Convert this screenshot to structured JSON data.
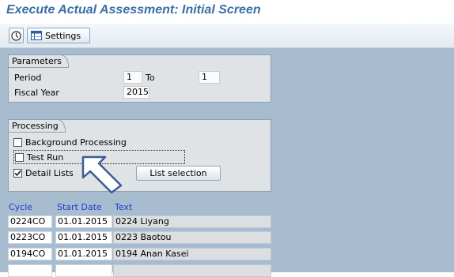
{
  "title": "Execute Actual Assessment: Initial Screen",
  "toolbar": {
    "execute_icon": "execute-icon",
    "settings_label": "Settings"
  },
  "parameters": {
    "heading": "Parameters",
    "period_label": "Period",
    "period_from": "1",
    "to_label": "To",
    "period_to": "1",
    "fiscal_year_label": "Fiscal Year",
    "fiscal_year": "2015"
  },
  "processing": {
    "heading": "Processing",
    "background_label": "Background Processing",
    "background_checked": false,
    "test_run_label": "Test Run",
    "test_run_checked": false,
    "detail_lists_label": "Detail Lists",
    "detail_lists_checked": true,
    "list_selection_label": "List selection"
  },
  "table": {
    "headers": [
      "Cycle",
      "Start Date",
      "Text"
    ],
    "rows": [
      {
        "cycle": "0224CO",
        "start_date": "01.01.2015",
        "text": "0224 Liyang"
      },
      {
        "cycle": "0223CO",
        "start_date": "01.01.2015",
        "text": "0223 Baotou"
      },
      {
        "cycle": "0194CO",
        "start_date": "01.01.2015",
        "text": "0194 Anan Kasei"
      },
      {
        "cycle": "",
        "start_date": "",
        "text": ""
      }
    ]
  },
  "colors": {
    "title": "#3a6ea5",
    "background": "#a8bccf",
    "group": "#dfe3e6",
    "column_header": "#1d3fd1"
  }
}
